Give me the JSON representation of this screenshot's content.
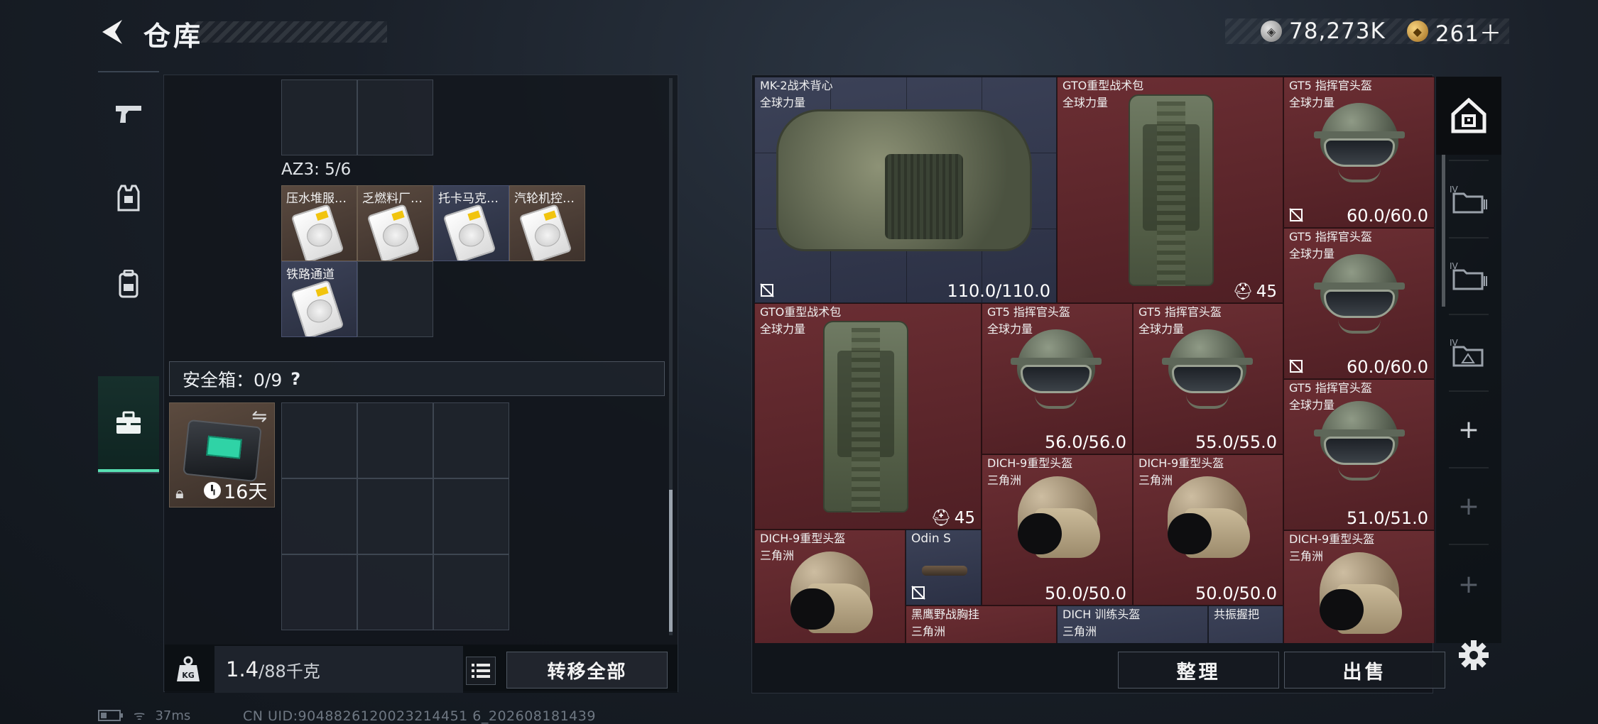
{
  "header": {
    "title": "仓库",
    "currencies": [
      {
        "icon": "silver-coin-icon",
        "value": "78,273K"
      },
      {
        "icon": "gold-coin-icon",
        "value": "261＋"
      }
    ]
  },
  "left_tabs": [
    {
      "icon": "pistol-icon",
      "active": false
    },
    {
      "icon": "armor-vest-icon",
      "active": false
    },
    {
      "icon": "backpack-icon",
      "active": false
    },
    {
      "icon": "briefcase-icon",
      "active": true
    }
  ],
  "container": {
    "section_label": "AZ3: 5/6",
    "items": [
      {
        "name": "压水堆服…"
      },
      {
        "name": "乏燃料厂…"
      },
      {
        "name": "托卡马克…"
      },
      {
        "name": "汽轮机控…"
      },
      {
        "name": "铁路通道"
      }
    ]
  },
  "safe_box": {
    "label": "安全箱：0/9",
    "help": "?",
    "case_timer": "16天"
  },
  "bottom_left": {
    "weight_value": "1.4",
    "weight_max": "/88千克",
    "transfer_all": "转移全部"
  },
  "stash": {
    "items": [
      {
        "name": "MK-2战术背心",
        "sub": "全球力量",
        "value": "110.0/110.0",
        "bg": "blue",
        "art": "vest"
      },
      {
        "name": "GTO重型战术包",
        "sub": "全球力量",
        "value": "45",
        "bg": "red",
        "art": "pack"
      },
      {
        "name": "GT5 指挥官头盔",
        "sub": "全球力量",
        "value": "60.0/60.0",
        "bg": "red",
        "art": "helmet"
      },
      {
        "name": "GT5 指挥官头盔",
        "sub": "全球力量",
        "value": "60.0/60.0",
        "bg": "red",
        "art": "helmet"
      },
      {
        "name": "GTO重型战术包",
        "sub": "全球力量",
        "value": "45",
        "bg": "red",
        "art": "pack"
      },
      {
        "name": "GT5 指挥官头盔",
        "sub": "全球力量",
        "value": "56.0/56.0",
        "bg": "red",
        "art": "helmet"
      },
      {
        "name": "GT5 指挥官头盔",
        "sub": "全球力量",
        "value": "55.0/55.0",
        "bg": "red",
        "art": "helmet"
      },
      {
        "name": "GT5 指挥官头盔",
        "sub": "全球力量",
        "value": "51.0/51.0",
        "bg": "red",
        "art": "helmet"
      },
      {
        "name": "DICH-9重型头盔",
        "sub": "三角洲",
        "value": "50.0/50.0",
        "bg": "red",
        "art": "camo"
      },
      {
        "name": "DICH-9重型头盔",
        "sub": "三角洲",
        "value": "50.0/50.0",
        "bg": "red",
        "art": "camo"
      },
      {
        "name": "DICH-9重型头盔",
        "sub": "三角洲",
        "value": "",
        "bg": "red",
        "art": "camo"
      },
      {
        "name": "Odin S",
        "sub": "",
        "value": "",
        "bg": "blue",
        "art": "scope"
      },
      {
        "name": "DICH-9重型头盔",
        "sub": "三角洲",
        "value": "",
        "bg": "red",
        "art": "camo"
      },
      {
        "name": "黑鹰野战胸挂",
        "sub": "三角洲",
        "value": "",
        "bg": "red",
        "art": "none"
      },
      {
        "name": "DICH 训练头盔",
        "sub": "三角洲",
        "value": "",
        "bg": "blue",
        "art": "none"
      },
      {
        "name": "共振握把",
        "sub": "",
        "value": "",
        "bg": "blue",
        "art": "none"
      }
    ],
    "sort_button": "整理",
    "sell_button": "出售",
    "tabs": [
      {
        "icon": "home-vault-icon",
        "label": ""
      },
      {
        "icon": "folder-icon",
        "label": "IV"
      },
      {
        "icon": "folder-icon",
        "label": "IV"
      },
      {
        "icon": "triangle-folder-icon",
        "label": "IV"
      },
      {
        "icon": "plus-icon",
        "label": "+"
      },
      {
        "icon": "plus-icon",
        "label": "+"
      },
      {
        "icon": "plus-icon",
        "label": "+"
      }
    ]
  },
  "status_bar": {
    "ping": "37ms",
    "uid": "CN UID:9048826120023214451 6_202608181439"
  },
  "colors": {
    "accent": "#58e0b3",
    "item_red": "#5e262b",
    "item_blue": "#3a4057",
    "item_brown": "#4d3f35"
  }
}
